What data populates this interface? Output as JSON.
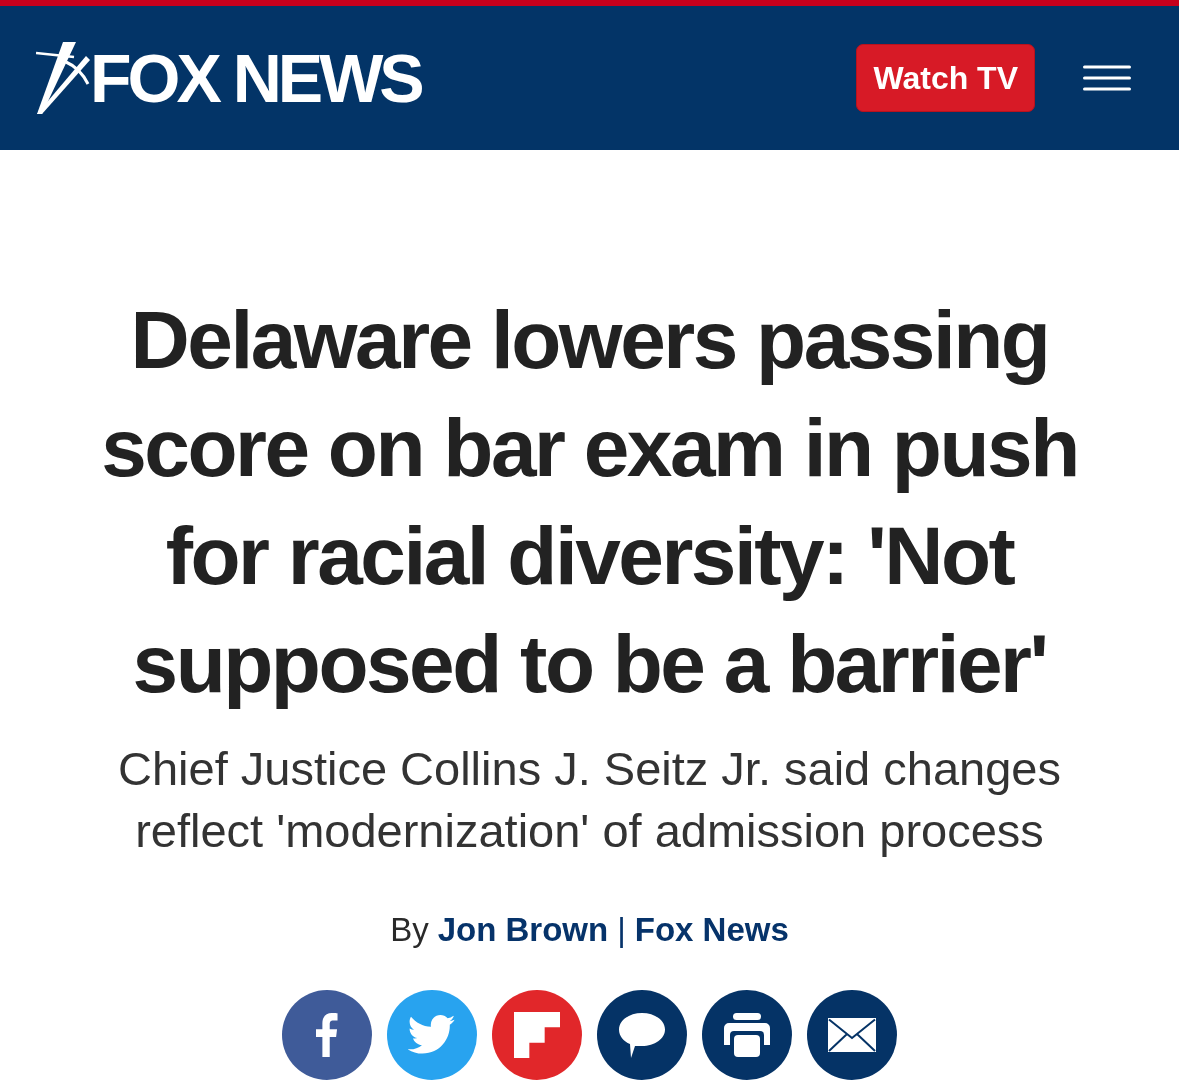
{
  "header": {
    "logo_text": "FOX NEWS",
    "watch_button": "Watch TV"
  },
  "article": {
    "headline": "Delaware lowers passing score on bar exam in push for racial diversity: 'Not supposed to be a barrier'",
    "subheadline": "Chief Justice Collins J. Seitz Jr. said changes reflect 'modernization' of admission process",
    "byline": {
      "prefix": "By",
      "author": "Jon Brown",
      "separator": "|",
      "source": "Fox News"
    }
  },
  "share_buttons": [
    {
      "kind": "facebook",
      "color": "#3f5b99"
    },
    {
      "kind": "twitter",
      "color": "#28a3ef"
    },
    {
      "kind": "flipboard",
      "color": "#e1272a"
    },
    {
      "kind": "comment",
      "color": "#053366"
    },
    {
      "kind": "print",
      "color": "#053366"
    },
    {
      "kind": "email",
      "color": "#053366"
    }
  ]
}
